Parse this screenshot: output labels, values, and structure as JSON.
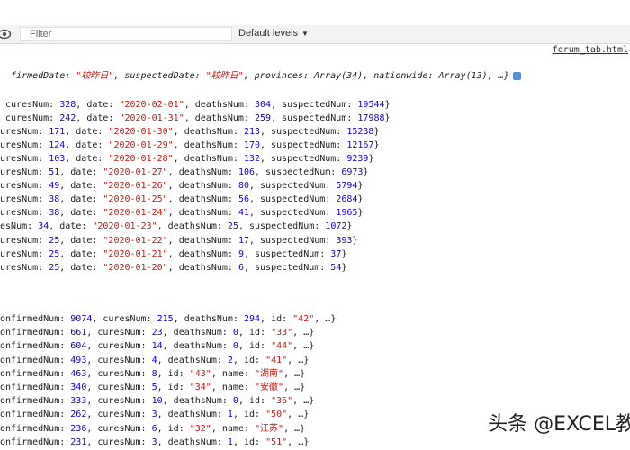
{
  "toolbar": {
    "filter_placeholder": "Filter",
    "levels_label": "Default levels",
    "levels_caret": "▼"
  },
  "source_link": "forum_tab.html",
  "summary_line": {
    "p1": "firmedDate: ",
    "v1": "\"较昨日\"",
    "p2": ", suspectedDate: ",
    "v2": "\"较昨日\"",
    "p3": ", provinces: Array(34), nationwide: Array(13), …}",
    "info": "i"
  },
  "nationwide_rows": [
    {
      "prefix": " curesNum: ",
      "cures": "328",
      "d1": ", date: ",
      "date": "\"2020-02-01\"",
      "d2": ", deathsNum: ",
      "deaths": "304",
      "d3": ", suspectedNum: ",
      "susp": "19544",
      "end": "}"
    },
    {
      "prefix": " curesNum: ",
      "cures": "242",
      "d1": ", date: ",
      "date": "\"2020-01-31\"",
      "d2": ", deathsNum: ",
      "deaths": "259",
      "d3": ", suspectedNum: ",
      "susp": "17988",
      "end": "}"
    },
    {
      "prefix": "uresNum: ",
      "cures": "171",
      "d1": ", date: ",
      "date": "\"2020-01-30\"",
      "d2": ", deathsNum: ",
      "deaths": "213",
      "d3": ", suspectedNum: ",
      "susp": "15238",
      "end": "}"
    },
    {
      "prefix": "uresNum: ",
      "cures": "124",
      "d1": ", date: ",
      "date": "\"2020-01-29\"",
      "d2": ", deathsNum: ",
      "deaths": "170",
      "d3": ", suspectedNum: ",
      "susp": "12167",
      "end": "}"
    },
    {
      "prefix": "uresNum: ",
      "cures": "103",
      "d1": ", date: ",
      "date": "\"2020-01-28\"",
      "d2": ", deathsNum: ",
      "deaths": "132",
      "d3": ", suspectedNum: ",
      "susp": "9239",
      "end": "}"
    },
    {
      "prefix": "uresNum: ",
      "cures": "51",
      "d1": ", date: ",
      "date": "\"2020-01-27\"",
      "d2": ", deathsNum: ",
      "deaths": "106",
      "d3": ", suspectedNum: ",
      "susp": "6973",
      "end": "}"
    },
    {
      "prefix": "uresNum: ",
      "cures": "49",
      "d1": ", date: ",
      "date": "\"2020-01-26\"",
      "d2": ", deathsNum: ",
      "deaths": "80",
      "d3": ", suspectedNum: ",
      "susp": "5794",
      "end": "}"
    },
    {
      "prefix": "uresNum: ",
      "cures": "38",
      "d1": ", date: ",
      "date": "\"2020-01-25\"",
      "d2": ", deathsNum: ",
      "deaths": "56",
      "d3": ", suspectedNum: ",
      "susp": "2684",
      "end": "}"
    },
    {
      "prefix": "uresNum: ",
      "cures": "38",
      "d1": ", date: ",
      "date": "\"2020-01-24\"",
      "d2": ", deathsNum: ",
      "deaths": "41",
      "d3": ", suspectedNum: ",
      "susp": "1965",
      "end": "}"
    },
    {
      "prefix": "resNum: ",
      "cures": "34",
      "d1": ", date: ",
      "date": "\"2020-01-23\"",
      "d2": ", deathsNum: ",
      "deaths": "25",
      "d3": ", suspectedNum: ",
      "susp": "1072",
      "end": "}"
    },
    {
      "prefix": "uresNum: ",
      "cures": "25",
      "d1": ", date: ",
      "date": "\"2020-01-22\"",
      "d2": ", deathsNum: ",
      "deaths": "17",
      "d3": ", suspectedNum: ",
      "susp": "393",
      "end": "}"
    },
    {
      "prefix": "uresNum: ",
      "cures": "25",
      "d1": ", date: ",
      "date": "\"2020-01-21\"",
      "d2": ", deathsNum: ",
      "deaths": "9",
      "d3": ", suspectedNum: ",
      "susp": "37",
      "end": "}"
    },
    {
      "prefix": "uresNum: ",
      "cures": "25",
      "d1": ", date: ",
      "date": "\"2020-01-20\"",
      "d2": ", deathsNum: ",
      "deaths": "6",
      "d3": ", suspectedNum: ",
      "susp": "54",
      "end": "}"
    }
  ],
  "province_rows": [
    {
      "a": "onfirmedNum: ",
      "b": "9074",
      "c": ", curesNum: ",
      "d": "215",
      "e": ", deathsNum: ",
      "f": "294",
      "g": ", id: ",
      "h": "\"42\"",
      "i": ", …}"
    },
    {
      "a": "onfirmedNum: ",
      "b": "661",
      "c": ", curesNum: ",
      "d": "23",
      "e": ", deathsNum: ",
      "f": "0",
      "g": ", id: ",
      "h": "\"33\"",
      "i": ", …}"
    },
    {
      "a": "onfirmedNum: ",
      "b": "604",
      "c": ", curesNum: ",
      "d": "14",
      "e": ", deathsNum: ",
      "f": "0",
      "g": ", id: ",
      "h": "\"44\"",
      "i": ", …}"
    },
    {
      "a": "onfirmedNum: ",
      "b": "493",
      "c": ", curesNum: ",
      "d": "4",
      "e": ", deathsNum: ",
      "f": "2",
      "g": ", id: ",
      "h": "\"41\"",
      "i": ", …}"
    },
    {
      "a": "onfirmedNum: ",
      "b": "463",
      "c": ", curesNum: ",
      "d": "8",
      "e": ", id: ",
      "f": "\"43\"",
      "g": ", name: ",
      "h": "\"湖南\"",
      "i": ", …}"
    },
    {
      "a": "onfirmedNum: ",
      "b": "340",
      "c": ", curesNum: ",
      "d": "5",
      "e": ", id: ",
      "f": "\"34\"",
      "g": ", name: ",
      "h": "\"安徽\"",
      "i": ", …}"
    },
    {
      "a": "onfirmedNum: ",
      "b": "333",
      "c": ", curesNum: ",
      "d": "10",
      "e": ", deathsNum: ",
      "f": "0",
      "g": ", id: ",
      "h": "\"36\"",
      "i": ", …}"
    },
    {
      "a": "onfirmedNum: ",
      "b": "262",
      "c": ", curesNum: ",
      "d": "3",
      "e": ", deathsNum: ",
      "f": "1",
      "g": ", id: ",
      "h": "\"50\"",
      "i": ", …}"
    },
    {
      "a": "onfirmedNum: ",
      "b": "236",
      "c": ", curesNum: ",
      "d": "6",
      "e": ", id: ",
      "f": "\"32\"",
      "g": ", name: ",
      "h": "\"江苏\"",
      "i": ", …}"
    },
    {
      "a": "onfirmedNum: ",
      "b": "231",
      "c": ", curesNum: ",
      "d": "3",
      "e": ", deathsNum: ",
      "f": "1",
      "g": ", id: ",
      "h": "\"51\"",
      "i": ", …}"
    }
  ],
  "watermark": "头条 @EXCEL教"
}
